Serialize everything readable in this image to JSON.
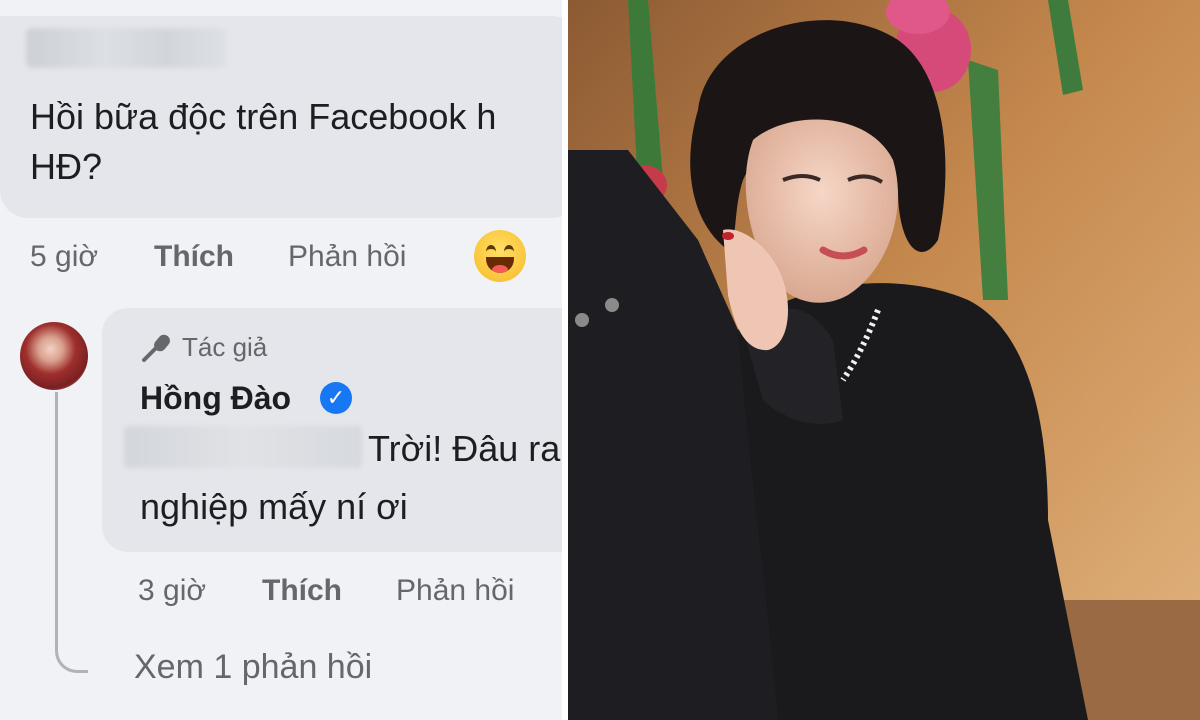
{
  "comment1": {
    "text": "Hồi bữa độc trên Facebook h\nHĐ?",
    "time": "5 giờ",
    "like": "Thích",
    "reply": "Phản hồi",
    "reaction_icon": "haha-emoji-icon"
  },
  "comment2": {
    "badge": "Tác giả",
    "badge_icon": "microphone-icon",
    "author": "Hồng Đào",
    "verified_icon": "verified-badge-icon",
    "text_line1": "Trời! Đâu ra",
    "text_line2": "nghiệp mấy ní ơi",
    "time": "3 giờ",
    "like": "Thích",
    "reply": "Phản hồi"
  },
  "view_replies": "Xem 1 phản hồi",
  "colors": {
    "bubble": "#e4e6eb",
    "meta_text": "#65676b",
    "verified": "#1877f2"
  }
}
